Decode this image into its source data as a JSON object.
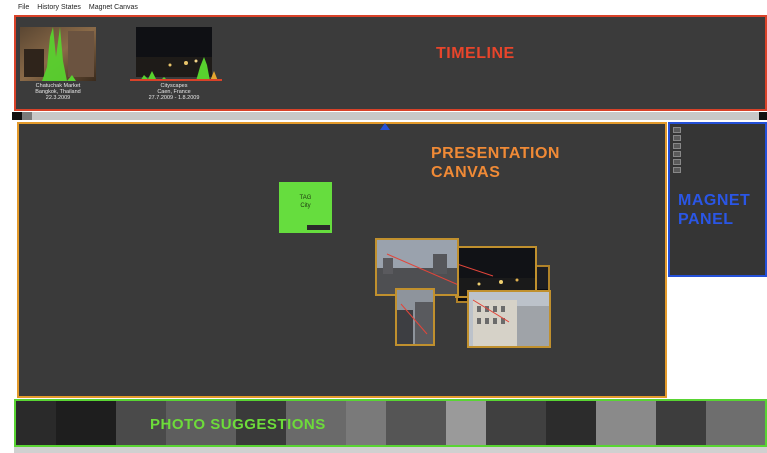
{
  "menu": {
    "items": [
      "File",
      "History States",
      "Magnet Canvas"
    ]
  },
  "timeline": {
    "label": "TIMELINE",
    "events": [
      {
        "title": "Chatuchak Market",
        "place": "Bangkok, Thailand",
        "date": "22.3.2009"
      },
      {
        "title": "Cityscapes",
        "place": "Caen, France",
        "date": "27.7.2009 - 1.8.2009"
      }
    ]
  },
  "canvas": {
    "label_line1": "PRESENTATION",
    "label_line2": "CANVAS",
    "tag": {
      "line1": "TAG",
      "line2": "City"
    }
  },
  "magnet": {
    "label_line1": "MAGNET",
    "label_line2": "PANEL",
    "items": [
      "",
      "",
      "",
      "",
      "",
      ""
    ]
  },
  "suggestions": {
    "label": "PHOTO SUGGESTIONS"
  },
  "colors": {
    "timeline": "#d94229",
    "canvas": "#e39a2b",
    "magnet": "#2450d8",
    "suggestions": "#59d433",
    "tag": "#66dd3e"
  },
  "icons": {
    "playhead": "triangle-up-icon"
  }
}
